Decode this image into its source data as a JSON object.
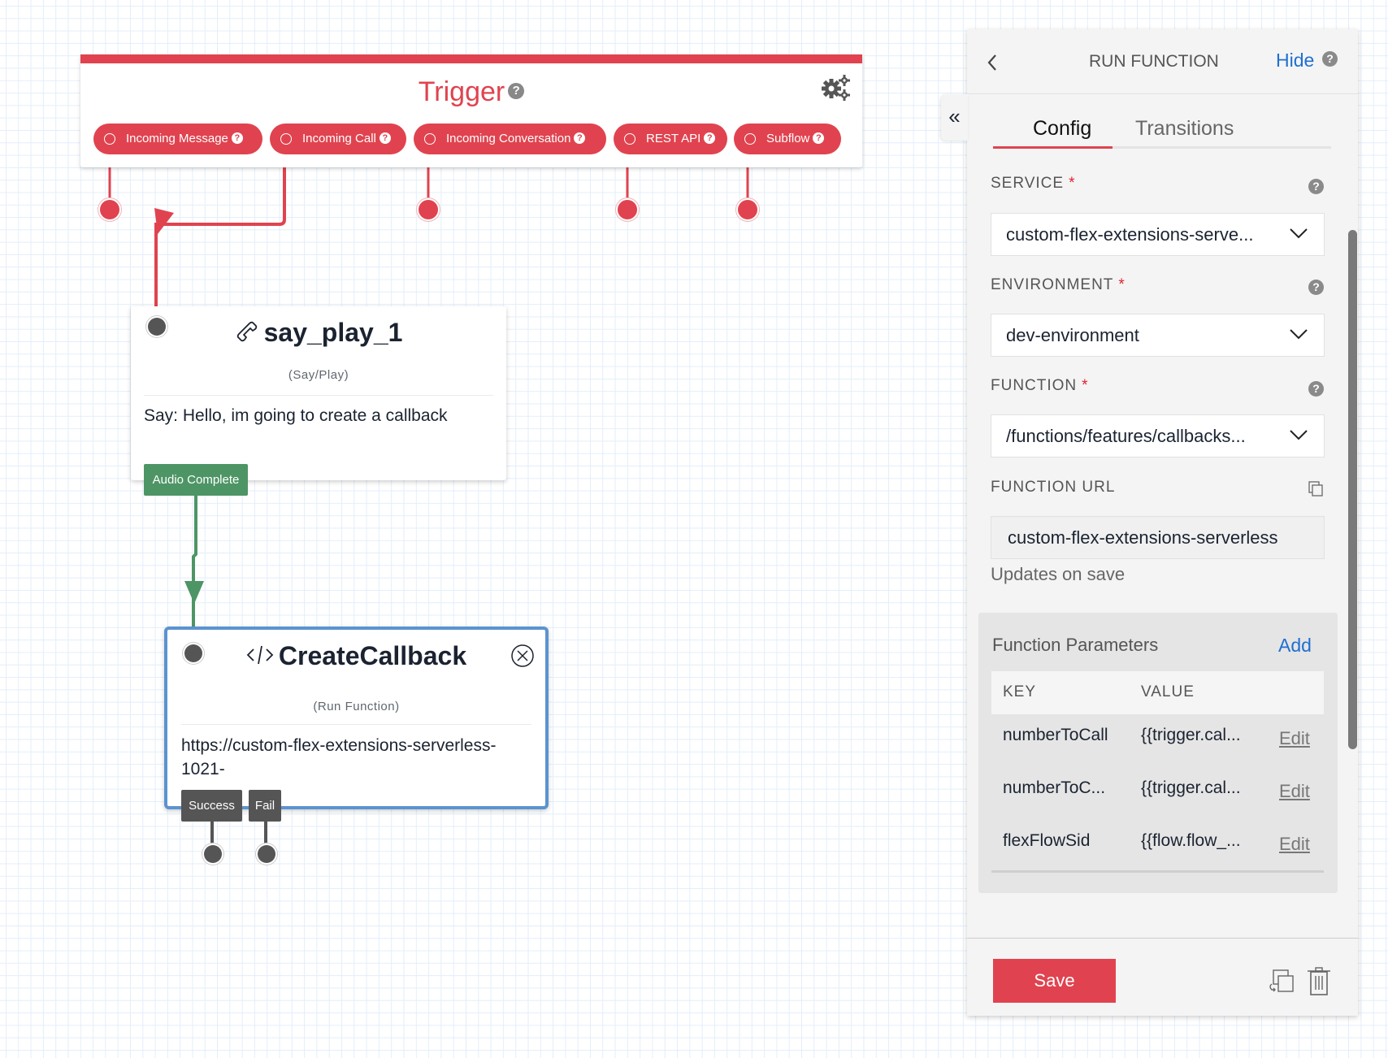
{
  "colors": {
    "brand_red": "#e0434f",
    "success_green": "#4e9566",
    "selection_blue": "#5b93d0",
    "link_blue": "#1f6fd1",
    "dark_badge": "#555555"
  },
  "trigger": {
    "title": "Trigger",
    "help_icon": "?",
    "settings_icon": "gears-icon",
    "pills": [
      {
        "label": "Incoming Message"
      },
      {
        "label": "Incoming Call"
      },
      {
        "label": "Incoming Conversation"
      },
      {
        "label": "REST API"
      },
      {
        "label": "Subflow"
      }
    ]
  },
  "nodes": {
    "say_play": {
      "icon": "phone-icon",
      "title": "say_play_1",
      "type": "(Say/Play)",
      "body": "Say: Hello, im going to create a callback",
      "transitions": [
        "Audio Complete"
      ]
    },
    "create_callback": {
      "icon": "code-icon",
      "title": "CreateCallback",
      "type": "(Run Function)",
      "body_line1": "https://custom-flex-extensions-serverless-",
      "body_line2": "1021-",
      "transitions": [
        "Success",
        "Fail"
      ]
    }
  },
  "panel": {
    "collapse_icon": "«",
    "back_icon": "chevron-left-icon",
    "title": "RUN FUNCTION",
    "hide_label": "Hide",
    "tabs": [
      {
        "label": "Config",
        "active": true
      },
      {
        "label": "Transitions",
        "active": false
      }
    ],
    "fields": {
      "service": {
        "label": "SERVICE",
        "required": "*",
        "value": "custom-flex-extensions-serve..."
      },
      "environment": {
        "label": "ENVIRONMENT",
        "required": "*",
        "value": "dev-environment"
      },
      "function": {
        "label": "FUNCTION",
        "required": "*",
        "value": "/functions/features/callbacks..."
      },
      "function_url": {
        "label": "FUNCTION URL",
        "value": "custom-flex-extensions-serverless",
        "hint": "Updates on save"
      }
    },
    "parameters": {
      "title": "Function Parameters",
      "add_label": "Add",
      "columns": [
        "KEY",
        "VALUE"
      ],
      "rows": [
        {
          "key": "numberToCall",
          "value": "{{trigger.cal...",
          "action": "Edit"
        },
        {
          "key": "numberToC...",
          "value": "{{trigger.cal...",
          "action": "Edit"
        },
        {
          "key": "flexFlowSid",
          "value": "{{flow.flow_...",
          "action": "Edit"
        }
      ]
    },
    "footer": {
      "save_label": "Save",
      "duplicate_icon": "duplicate-icon",
      "delete_icon": "trash-icon"
    }
  }
}
